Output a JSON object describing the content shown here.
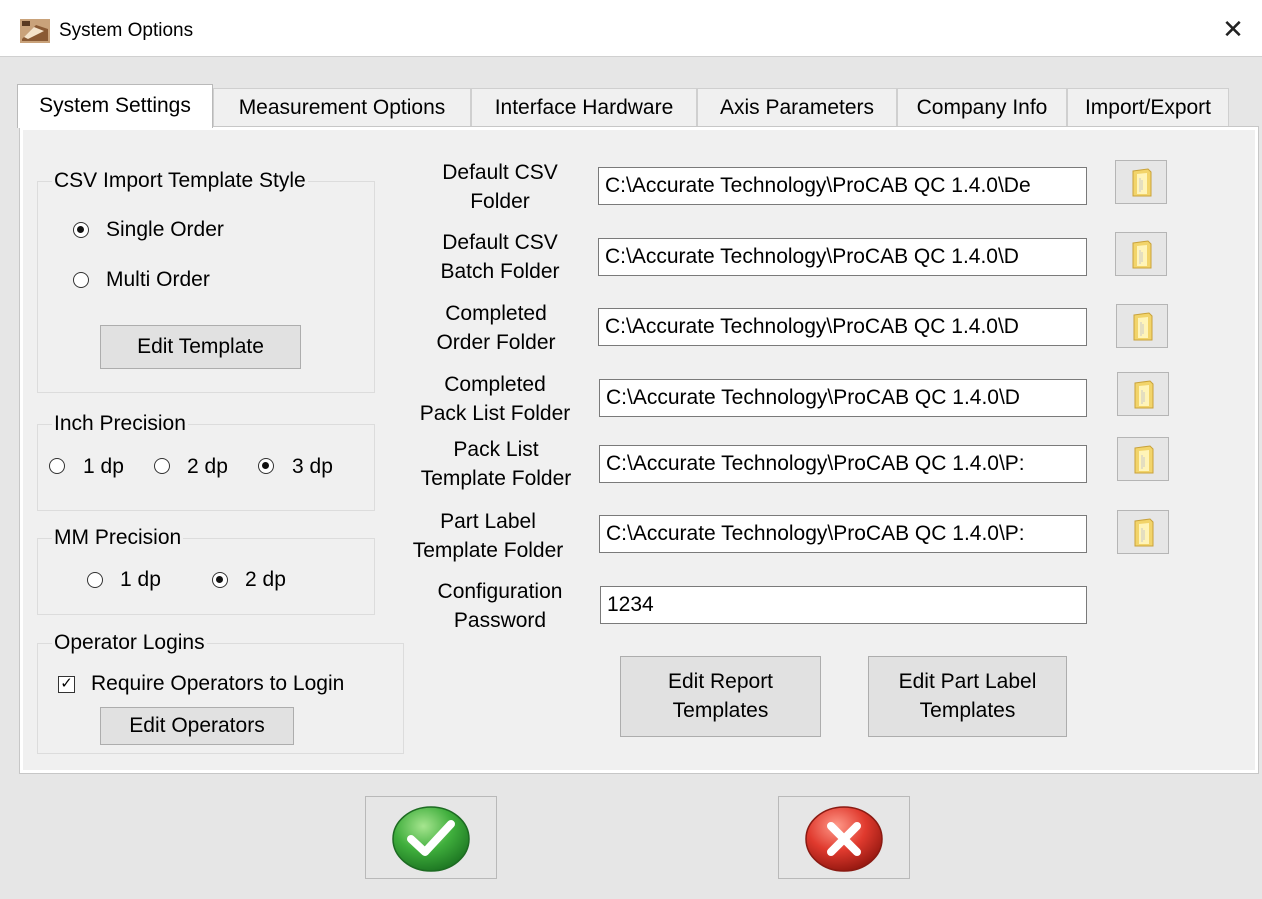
{
  "window": {
    "title": "System Options",
    "close_glyph": "✕"
  },
  "tabs": [
    {
      "label": "System Settings",
      "active": true
    },
    {
      "label": "Measurement Options"
    },
    {
      "label": "Interface Hardware"
    },
    {
      "label": "Axis Parameters"
    },
    {
      "label": "Company Info"
    },
    {
      "label": "Import/Export"
    }
  ],
  "csv_group": {
    "title": "CSV Import Template Style",
    "options": [
      "Single Order",
      "Multi Order"
    ],
    "selected": "Single Order",
    "edit_button": "Edit Template"
  },
  "inch_precision": {
    "title": "Inch Precision",
    "options": [
      "1 dp",
      "2 dp",
      "3 dp"
    ],
    "selected": "3 dp"
  },
  "mm_precision": {
    "title": "MM Precision",
    "options": [
      "1 dp",
      "2 dp"
    ],
    "selected": "2 dp"
  },
  "operator_logins": {
    "title": "Operator Logins",
    "checkbox_label": "Require Operators to Login",
    "checked": true,
    "check_glyph": "✓",
    "edit_button": "Edit Operators"
  },
  "folders": [
    {
      "label_line1": "Default CSV",
      "label_line2": "Folder",
      "value": "C:\\Accurate Technology\\ProCAB QC 1.4.0\\De"
    },
    {
      "label_line1": "Default CSV",
      "label_line2": "Batch Folder",
      "value": "C:\\Accurate Technology\\ProCAB QC 1.4.0\\D"
    },
    {
      "label_line1": "Completed",
      "label_line2": "Order Folder",
      "value": "C:\\Accurate Technology\\ProCAB QC 1.4.0\\D"
    },
    {
      "label_line1": "Completed",
      "label_line2": "Pack List Folder",
      "value": "C:\\Accurate Technology\\ProCAB QC 1.4.0\\D"
    },
    {
      "label_line1": "Pack List",
      "label_line2": "Template Folder",
      "value": "C:\\Accurate Technology\\ProCAB QC 1.4.0\\P:"
    },
    {
      "label_line1": "Part Label",
      "label_line2": "Template Folder",
      "value": "C:\\Accurate Technology\\ProCAB QC 1.4.0\\P:"
    }
  ],
  "password": {
    "label_line1": "Configuration",
    "label_line2": "Password",
    "value": "1234"
  },
  "report_buttons": {
    "edit_report": {
      "line1": "Edit Report",
      "line2": "Templates"
    },
    "edit_part_label": {
      "line1": "Edit Part Label",
      "line2": "Templates"
    }
  },
  "icons": {
    "app": "cabinet-app-icon",
    "folder": "folder-icon",
    "ok": "green-check-icon",
    "cancel": "red-x-icon"
  },
  "colors": {
    "ok_green": "#3fae3c",
    "cancel_red": "#e03a2e",
    "folder_yellow": "#f2d46a"
  }
}
